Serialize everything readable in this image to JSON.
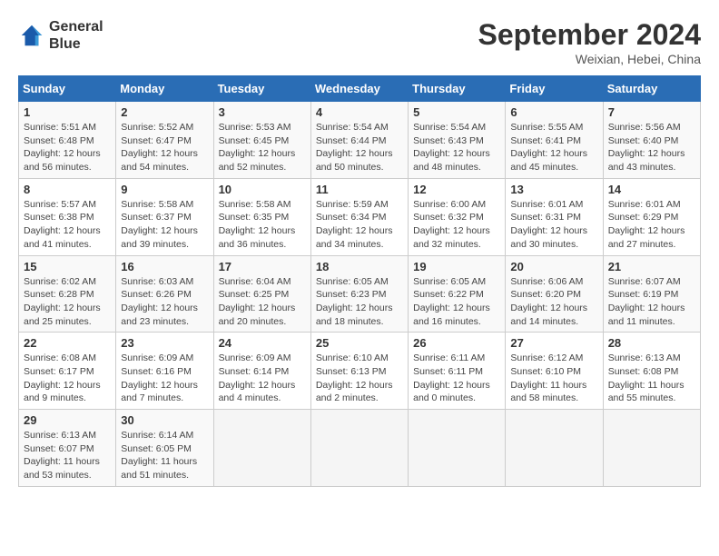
{
  "header": {
    "logo_line1": "General",
    "logo_line2": "Blue",
    "title": "September 2024",
    "location": "Weixian, Hebei, China"
  },
  "days_of_week": [
    "Sunday",
    "Monday",
    "Tuesday",
    "Wednesday",
    "Thursday",
    "Friday",
    "Saturday"
  ],
  "weeks": [
    [
      {
        "num": "1",
        "info": "Sunrise: 5:51 AM\nSunset: 6:48 PM\nDaylight: 12 hours\nand 56 minutes."
      },
      {
        "num": "2",
        "info": "Sunrise: 5:52 AM\nSunset: 6:47 PM\nDaylight: 12 hours\nand 54 minutes."
      },
      {
        "num": "3",
        "info": "Sunrise: 5:53 AM\nSunset: 6:45 PM\nDaylight: 12 hours\nand 52 minutes."
      },
      {
        "num": "4",
        "info": "Sunrise: 5:54 AM\nSunset: 6:44 PM\nDaylight: 12 hours\nand 50 minutes."
      },
      {
        "num": "5",
        "info": "Sunrise: 5:54 AM\nSunset: 6:43 PM\nDaylight: 12 hours\nand 48 minutes."
      },
      {
        "num": "6",
        "info": "Sunrise: 5:55 AM\nSunset: 6:41 PM\nDaylight: 12 hours\nand 45 minutes."
      },
      {
        "num": "7",
        "info": "Sunrise: 5:56 AM\nSunset: 6:40 PM\nDaylight: 12 hours\nand 43 minutes."
      }
    ],
    [
      {
        "num": "8",
        "info": "Sunrise: 5:57 AM\nSunset: 6:38 PM\nDaylight: 12 hours\nand 41 minutes."
      },
      {
        "num": "9",
        "info": "Sunrise: 5:58 AM\nSunset: 6:37 PM\nDaylight: 12 hours\nand 39 minutes."
      },
      {
        "num": "10",
        "info": "Sunrise: 5:58 AM\nSunset: 6:35 PM\nDaylight: 12 hours\nand 36 minutes."
      },
      {
        "num": "11",
        "info": "Sunrise: 5:59 AM\nSunset: 6:34 PM\nDaylight: 12 hours\nand 34 minutes."
      },
      {
        "num": "12",
        "info": "Sunrise: 6:00 AM\nSunset: 6:32 PM\nDaylight: 12 hours\nand 32 minutes."
      },
      {
        "num": "13",
        "info": "Sunrise: 6:01 AM\nSunset: 6:31 PM\nDaylight: 12 hours\nand 30 minutes."
      },
      {
        "num": "14",
        "info": "Sunrise: 6:01 AM\nSunset: 6:29 PM\nDaylight: 12 hours\nand 27 minutes."
      }
    ],
    [
      {
        "num": "15",
        "info": "Sunrise: 6:02 AM\nSunset: 6:28 PM\nDaylight: 12 hours\nand 25 minutes."
      },
      {
        "num": "16",
        "info": "Sunrise: 6:03 AM\nSunset: 6:26 PM\nDaylight: 12 hours\nand 23 minutes."
      },
      {
        "num": "17",
        "info": "Sunrise: 6:04 AM\nSunset: 6:25 PM\nDaylight: 12 hours\nand 20 minutes."
      },
      {
        "num": "18",
        "info": "Sunrise: 6:05 AM\nSunset: 6:23 PM\nDaylight: 12 hours\nand 18 minutes."
      },
      {
        "num": "19",
        "info": "Sunrise: 6:05 AM\nSunset: 6:22 PM\nDaylight: 12 hours\nand 16 minutes."
      },
      {
        "num": "20",
        "info": "Sunrise: 6:06 AM\nSunset: 6:20 PM\nDaylight: 12 hours\nand 14 minutes."
      },
      {
        "num": "21",
        "info": "Sunrise: 6:07 AM\nSunset: 6:19 PM\nDaylight: 12 hours\nand 11 minutes."
      }
    ],
    [
      {
        "num": "22",
        "info": "Sunrise: 6:08 AM\nSunset: 6:17 PM\nDaylight: 12 hours\nand 9 minutes."
      },
      {
        "num": "23",
        "info": "Sunrise: 6:09 AM\nSunset: 6:16 PM\nDaylight: 12 hours\nand 7 minutes."
      },
      {
        "num": "24",
        "info": "Sunrise: 6:09 AM\nSunset: 6:14 PM\nDaylight: 12 hours\nand 4 minutes."
      },
      {
        "num": "25",
        "info": "Sunrise: 6:10 AM\nSunset: 6:13 PM\nDaylight: 12 hours\nand 2 minutes."
      },
      {
        "num": "26",
        "info": "Sunrise: 6:11 AM\nSunset: 6:11 PM\nDaylight: 12 hours\nand 0 minutes."
      },
      {
        "num": "27",
        "info": "Sunrise: 6:12 AM\nSunset: 6:10 PM\nDaylight: 11 hours\nand 58 minutes."
      },
      {
        "num": "28",
        "info": "Sunrise: 6:13 AM\nSunset: 6:08 PM\nDaylight: 11 hours\nand 55 minutes."
      }
    ],
    [
      {
        "num": "29",
        "info": "Sunrise: 6:13 AM\nSunset: 6:07 PM\nDaylight: 11 hours\nand 53 minutes."
      },
      {
        "num": "30",
        "info": "Sunrise: 6:14 AM\nSunset: 6:05 PM\nDaylight: 11 hours\nand 51 minutes."
      },
      {
        "num": "",
        "info": ""
      },
      {
        "num": "",
        "info": ""
      },
      {
        "num": "",
        "info": ""
      },
      {
        "num": "",
        "info": ""
      },
      {
        "num": "",
        "info": ""
      }
    ]
  ]
}
